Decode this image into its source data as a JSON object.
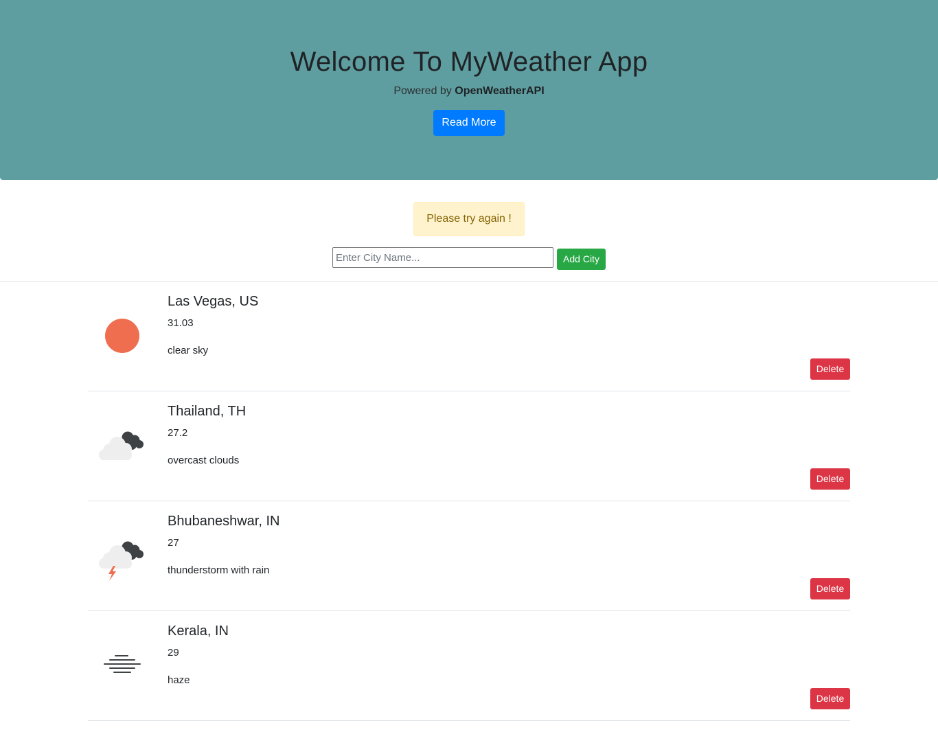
{
  "hero": {
    "title": "Welcome To MyWeather App",
    "powered_prefix": "Powered by",
    "powered_brand": "OpenWeatherAPI",
    "read_more_label": "Read More",
    "background_color": "#5f9ea0"
  },
  "alert": {
    "message": "Please try again !"
  },
  "search": {
    "placeholder": "Enter City Name...",
    "value": "",
    "add_label": "Add City"
  },
  "cities": [
    {
      "name": "Las Vegas, US",
      "temp": "31.03",
      "description": "clear sky",
      "icon": "sun-icon",
      "delete_label": "Delete"
    },
    {
      "name": "Thailand, TH",
      "temp": "27.2",
      "description": "overcast clouds",
      "icon": "overcast-clouds-icon",
      "delete_label": "Delete"
    },
    {
      "name": "Bhubaneshwar, IN",
      "temp": "27",
      "description": "thunderstorm with rain",
      "icon": "thunderstorm-icon",
      "delete_label": "Delete"
    },
    {
      "name": "Kerala, IN",
      "temp": "29",
      "description": "haze",
      "icon": "haze-icon",
      "delete_label": "Delete"
    }
  ],
  "colors": {
    "primary": "#007bff",
    "success": "#28a745",
    "danger": "#dc3545",
    "warning_bg": "#fff3cd",
    "warning_text": "#856404"
  }
}
